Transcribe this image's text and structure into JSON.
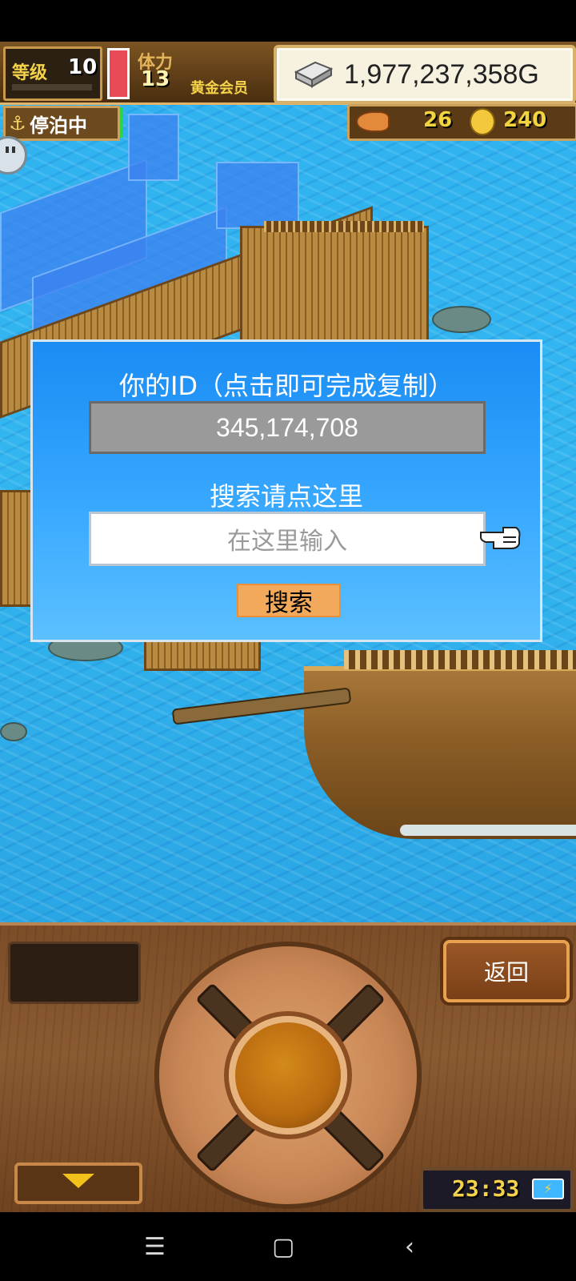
{
  "hud": {
    "level_label": "等级",
    "level_value": "10",
    "stamina_label": "体力",
    "stamina_value": "13",
    "member_label": "黄金会员",
    "money": "1,977,237,358G",
    "status_badge": "停泊中",
    "fish_count": "26",
    "coin_count": "240"
  },
  "dialog": {
    "title": "你的ID（点击即可完成复制）",
    "user_id": "345,174,708",
    "search_hint": "搜索请点这里",
    "search_placeholder": "在这里输入",
    "search_button": "搜索"
  },
  "panel": {
    "back_button": "返回",
    "clock": "23:33"
  },
  "navbar": {
    "menu_icon": "☰",
    "home_icon": "▢",
    "back_icon": "‹"
  },
  "colors": {
    "ocean": "#2fb2ef",
    "dialog_blue": "#1a8cf4",
    "search_button": "#f3a95c",
    "gold_text": "#f2d53e"
  }
}
